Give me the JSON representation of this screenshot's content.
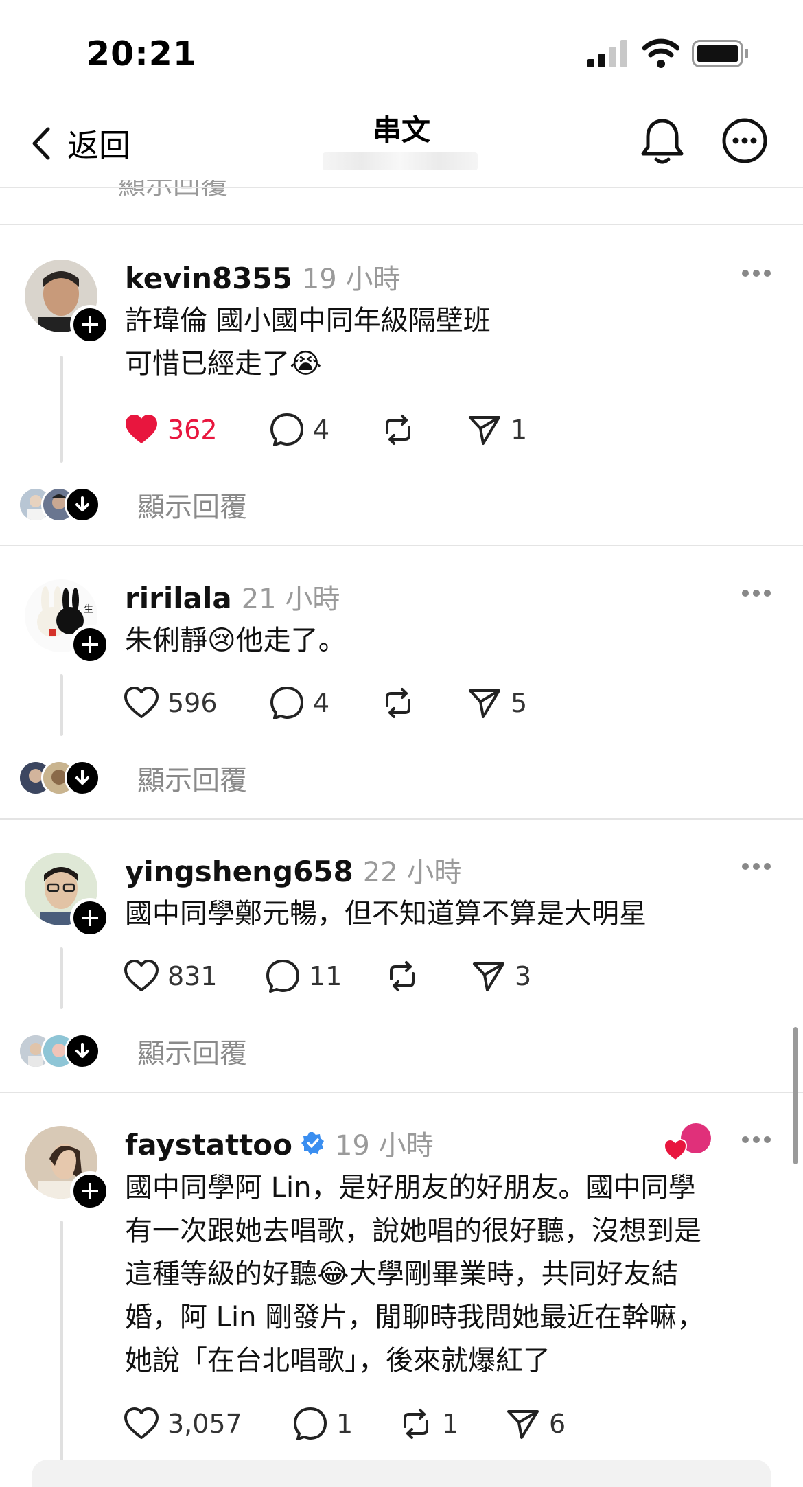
{
  "status_bar": {
    "time": "20:21"
  },
  "nav": {
    "back_label": "返回",
    "title": "串文"
  },
  "partial_reply": {
    "label": "顯示回覆"
  },
  "posts": [
    {
      "username": "kevin8355",
      "time": "19 小時",
      "text": "許瑋倫 國小國中同年級隔壁班\n可惜已經走了😭",
      "likes": "362",
      "liked": true,
      "comments": "4",
      "reposts": "",
      "shares": "1",
      "show_replies": "顯示回覆"
    },
    {
      "username": "ririlala",
      "time": "21 小時",
      "text": "朱俐靜😢他走了。",
      "likes": "596",
      "liked": false,
      "comments": "4",
      "reposts": "",
      "shares": "5",
      "show_replies": "顯示回覆"
    },
    {
      "username": "yingsheng658",
      "time": "22 小時",
      "text": "國中同學鄭元暢，但不知道算不算是大明星",
      "likes": "831",
      "liked": false,
      "comments": "11",
      "reposts": "",
      "shares": "3",
      "show_replies": "顯示回覆"
    },
    {
      "username": "faystattoo",
      "verified": true,
      "time": "19 小時",
      "text": "國中同學阿 Lin，是好朋友的好朋友。國中同學\n有一次跟她去唱歌，說她唱的很好聽，沒想到是\n這種等級的好聽😂大學剛畢業時，共同好友結\n婚，阿 Lin 剛發片，閒聊時我問她最近在幹嘛，\n她說「在台北唱歌」，後來就爆紅了",
      "likes": "3,057",
      "liked": false,
      "comments": "1",
      "reposts": "1",
      "shares": "6"
    }
  ],
  "colors": {
    "like_red": "#e8163e",
    "verified_blue": "#3a8ef0",
    "muted_gray": "#9a9a9a"
  }
}
